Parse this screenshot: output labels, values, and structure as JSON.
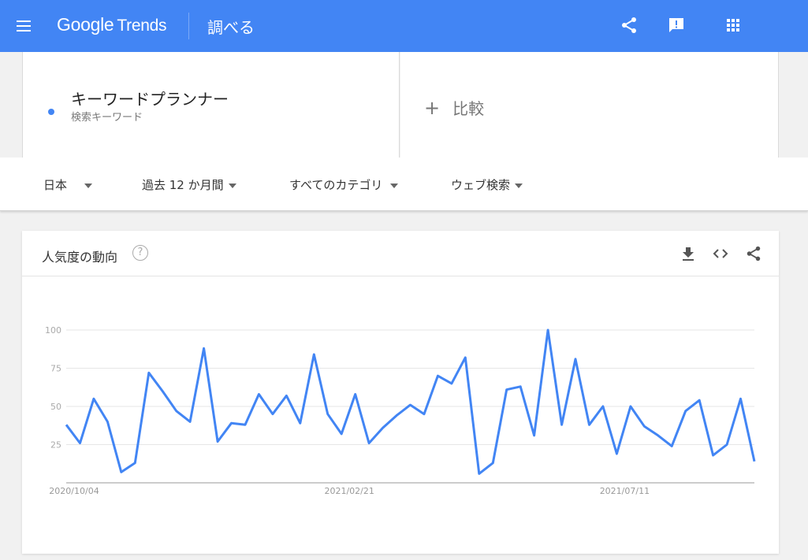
{
  "header": {
    "logo_google": "Google",
    "logo_trends": "Trends",
    "section": "調べる",
    "icons": [
      "menu-icon",
      "share-icon",
      "feedback-icon",
      "apps-icon"
    ]
  },
  "search": {
    "term": "キーワードプランナー",
    "term_type": "検索キーワード",
    "term_color": "#4285f4",
    "compare_label": "比較"
  },
  "filters": {
    "region": "日本",
    "period": "過去 12 か月間",
    "category": "すべてのカテゴリ",
    "property": "ウェブ検索"
  },
  "interest_card": {
    "title": "人気度の動向",
    "help_symbol": "?",
    "icons": [
      "download-icon",
      "embed-icon",
      "share-icon"
    ]
  },
  "chart_data": {
    "type": "line",
    "title": "",
    "xlabel": "",
    "ylabel": "",
    "ylim": [
      0,
      100
    ],
    "yticks": [
      25,
      50,
      75,
      100
    ],
    "xtick_labels": [
      "2020/10/04",
      "2021/02/21",
      "2021/07/11"
    ],
    "xtick_indices": [
      0,
      20,
      40
    ],
    "grid": true,
    "series": [
      {
        "color": "#4285f4",
        "values": [
          38,
          26,
          55,
          40,
          7,
          13,
          72,
          60,
          47,
          40,
          88,
          27,
          39,
          38,
          58,
          45,
          57,
          39,
          84,
          45,
          32,
          58,
          26,
          36,
          44,
          51,
          45,
          70,
          65,
          82,
          6,
          13,
          61,
          63,
          31,
          100,
          38,
          81,
          38,
          50,
          19,
          50,
          37,
          31,
          24,
          47,
          54,
          18,
          25,
          55,
          14
        ]
      }
    ]
  }
}
